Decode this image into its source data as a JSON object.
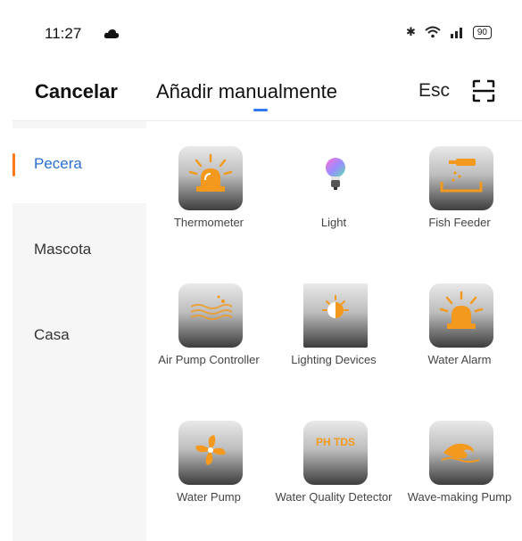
{
  "status_bar": {
    "time": "11:27",
    "battery": "90"
  },
  "header": {
    "cancel": "Cancelar",
    "title": "Añadir manualmente",
    "esc": "Esc"
  },
  "sidebar": {
    "items": [
      {
        "label": "Pecera",
        "active": true
      },
      {
        "label": "Mascota",
        "active": false
      },
      {
        "label": "Casa",
        "active": false
      }
    ]
  },
  "devices": [
    {
      "label": "Thermometer",
      "icon": "alarm-light-icon"
    },
    {
      "label": "Light",
      "icon": "light-bulb-icon"
    },
    {
      "label": "Fish Feeder",
      "icon": "fish-feeder-icon"
    },
    {
      "label": "Air Pump Controller",
      "icon": "air-pump-icon"
    },
    {
      "label": "Lighting Devices",
      "icon": "lighting-devices-icon"
    },
    {
      "label": "Water Alarm",
      "icon": "water-alarm-icon"
    },
    {
      "label": "Water Pump",
      "icon": "water-pump-icon"
    },
    {
      "label": "Water Quality Detector",
      "icon": "ph-tds-icon",
      "text": "PH TDS"
    },
    {
      "label": "Wave-making Pump",
      "icon": "wave-pump-icon"
    }
  ],
  "colors": {
    "accent": "#2f7bf6",
    "active_text": "#2a6fd6",
    "indicator": "#ff7a1a",
    "icon_orange": "#f39a1e"
  }
}
